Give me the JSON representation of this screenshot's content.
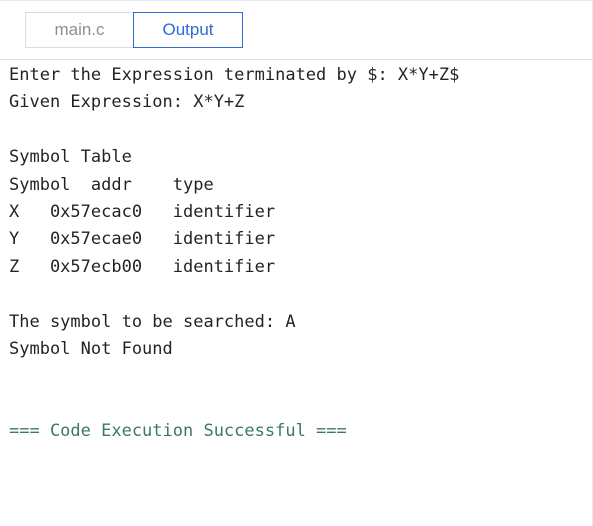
{
  "tabs": [
    {
      "label": "main.c",
      "active": false
    },
    {
      "label": "Output",
      "active": true
    }
  ],
  "console": {
    "lines": [
      "Enter the Expression terminated by $: X*Y+Z$",
      "Given Expression: X*Y+Z",
      "",
      "Symbol Table",
      "Symbol  addr    type",
      "X   0x57ecac0   identifier",
      "Y   0x57ecae0   identifier",
      "Z   0x57ecb00   identifier",
      "",
      "The symbol to be searched: A",
      "Symbol Not Found",
      "",
      "",
      "=== Code Execution Successful ==="
    ]
  },
  "colors": {
    "accent": "#2f6bd8",
    "success_text": "#3d7a5c",
    "text": "#1f2328"
  }
}
